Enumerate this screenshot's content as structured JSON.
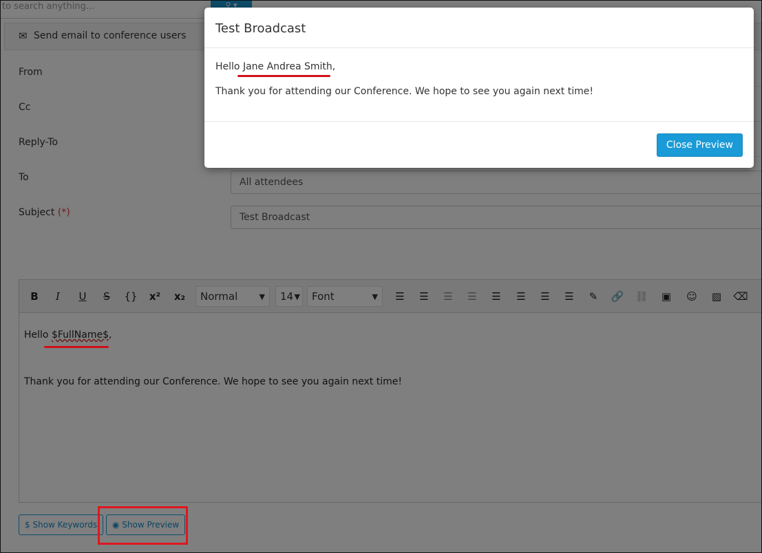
{
  "search": {
    "placeholder": "to search anything...",
    "button_icon": "search-icon"
  },
  "panel": {
    "title": "Send email to conference users",
    "icon": "envelope-icon"
  },
  "form": {
    "from_label": "From",
    "cc_label": "Cc",
    "reply_to_label": "Reply-To",
    "to_label": "To",
    "to_value": "All attendees",
    "subject_label": "Subject",
    "subject_required": "(*)",
    "subject_value": "Test Broadcast"
  },
  "editor": {
    "style_dropdown": "Normal",
    "size_dropdown": "14",
    "font_dropdown": "Font",
    "line1_prefix": "Hello ",
    "line1_keyword": "$FullName$",
    "line1_suffix": ",",
    "line2": "Thank you for attending our Conference. We hope to see you again next time!"
  },
  "buttons": {
    "show_keywords_icon": "$",
    "show_keywords": "Show Keywords",
    "show_preview": "Show Preview"
  },
  "modal": {
    "title": "Test Broadcast",
    "greeting_prefix": "Hello ",
    "greeting_name": "Jane Andrea Smith,",
    "message": "Thank you for attending our Conference. We hope to see you again next time!",
    "close_button": "Close Preview"
  },
  "colors": {
    "primary": "#1a9bd7",
    "annotation_red": "#e0161f",
    "required": "#e23b3b"
  }
}
